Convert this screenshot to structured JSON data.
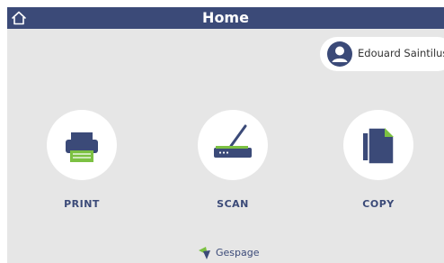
{
  "header": {
    "title": "Home",
    "home_icon": "home-icon"
  },
  "user": {
    "name": "Edouard Saintilus",
    "avatar_icon": "user-icon"
  },
  "actions": [
    {
      "label": "PRINT",
      "icon": "printer-icon"
    },
    {
      "label": "SCAN",
      "icon": "scanner-icon"
    },
    {
      "label": "COPY",
      "icon": "copy-icon"
    }
  ],
  "brand": {
    "name": "Gespage"
  },
  "colors": {
    "topbar": "#3b4a78",
    "background": "#e6e6e6",
    "accent_green": "#7cc142",
    "text": "#3b4a78"
  }
}
